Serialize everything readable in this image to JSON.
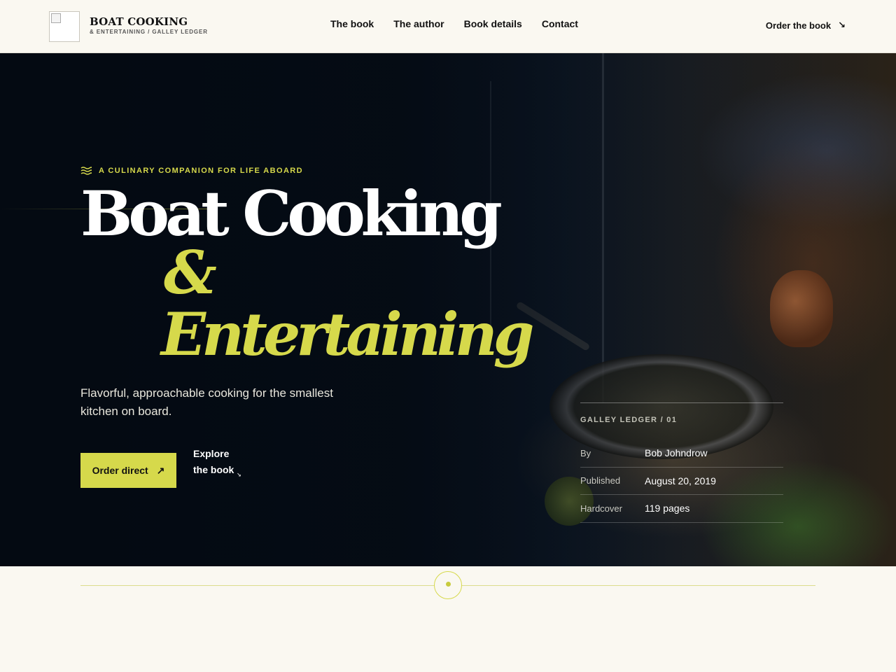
{
  "header": {
    "brand_title": "BOAT COOKING",
    "brand_sub": "& ENTERTAINING / GALLEY LEDGER",
    "nav": [
      {
        "label": "The book"
      },
      {
        "label": "The author"
      },
      {
        "label": "Book details"
      },
      {
        "label": "Contact"
      }
    ],
    "order_label": "Order the book"
  },
  "hero": {
    "eyebrow": "A CULINARY COMPANION FOR LIFE ABOARD",
    "title_line1": "Boat Cooking",
    "title_line2": "&",
    "title_line3": "Entertaining",
    "lede": "Flavorful, approachable cooking for the smallest kitchen on board.",
    "order_direct": "Order direct",
    "explore": "Explore the book"
  },
  "details": {
    "label": "GALLEY LEDGER / 01",
    "rows": [
      {
        "key": "By",
        "value": "Bob Johndrow"
      },
      {
        "key": "Published",
        "value": "August 20, 2019"
      },
      {
        "key": "Hardcover",
        "value": "119 pages"
      }
    ]
  },
  "colors": {
    "accent": "#d6d94b",
    "background": "#faf8f1",
    "hero_dark": "#050b14"
  }
}
